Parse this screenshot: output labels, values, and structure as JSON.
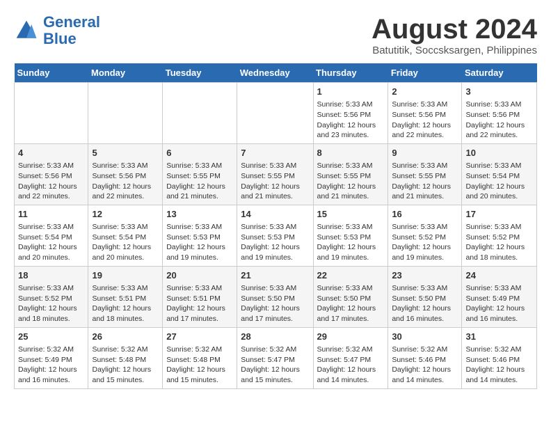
{
  "header": {
    "logo_line1": "General",
    "logo_line2": "Blue",
    "month_title": "August 2024",
    "subtitle": "Batutitik, Soccsksargen, Philippines"
  },
  "weekdays": [
    "Sunday",
    "Monday",
    "Tuesday",
    "Wednesday",
    "Thursday",
    "Friday",
    "Saturday"
  ],
  "weeks": [
    [
      {
        "day": "",
        "info": ""
      },
      {
        "day": "",
        "info": ""
      },
      {
        "day": "",
        "info": ""
      },
      {
        "day": "",
        "info": ""
      },
      {
        "day": "1",
        "info": "Sunrise: 5:33 AM\nSunset: 5:56 PM\nDaylight: 12 hours\nand 23 minutes."
      },
      {
        "day": "2",
        "info": "Sunrise: 5:33 AM\nSunset: 5:56 PM\nDaylight: 12 hours\nand 22 minutes."
      },
      {
        "day": "3",
        "info": "Sunrise: 5:33 AM\nSunset: 5:56 PM\nDaylight: 12 hours\nand 22 minutes."
      }
    ],
    [
      {
        "day": "4",
        "info": "Sunrise: 5:33 AM\nSunset: 5:56 PM\nDaylight: 12 hours\nand 22 minutes."
      },
      {
        "day": "5",
        "info": "Sunrise: 5:33 AM\nSunset: 5:56 PM\nDaylight: 12 hours\nand 22 minutes."
      },
      {
        "day": "6",
        "info": "Sunrise: 5:33 AM\nSunset: 5:55 PM\nDaylight: 12 hours\nand 21 minutes."
      },
      {
        "day": "7",
        "info": "Sunrise: 5:33 AM\nSunset: 5:55 PM\nDaylight: 12 hours\nand 21 minutes."
      },
      {
        "day": "8",
        "info": "Sunrise: 5:33 AM\nSunset: 5:55 PM\nDaylight: 12 hours\nand 21 minutes."
      },
      {
        "day": "9",
        "info": "Sunrise: 5:33 AM\nSunset: 5:55 PM\nDaylight: 12 hours\nand 21 minutes."
      },
      {
        "day": "10",
        "info": "Sunrise: 5:33 AM\nSunset: 5:54 PM\nDaylight: 12 hours\nand 20 minutes."
      }
    ],
    [
      {
        "day": "11",
        "info": "Sunrise: 5:33 AM\nSunset: 5:54 PM\nDaylight: 12 hours\nand 20 minutes."
      },
      {
        "day": "12",
        "info": "Sunrise: 5:33 AM\nSunset: 5:54 PM\nDaylight: 12 hours\nand 20 minutes."
      },
      {
        "day": "13",
        "info": "Sunrise: 5:33 AM\nSunset: 5:53 PM\nDaylight: 12 hours\nand 19 minutes."
      },
      {
        "day": "14",
        "info": "Sunrise: 5:33 AM\nSunset: 5:53 PM\nDaylight: 12 hours\nand 19 minutes."
      },
      {
        "day": "15",
        "info": "Sunrise: 5:33 AM\nSunset: 5:53 PM\nDaylight: 12 hours\nand 19 minutes."
      },
      {
        "day": "16",
        "info": "Sunrise: 5:33 AM\nSunset: 5:52 PM\nDaylight: 12 hours\nand 19 minutes."
      },
      {
        "day": "17",
        "info": "Sunrise: 5:33 AM\nSunset: 5:52 PM\nDaylight: 12 hours\nand 18 minutes."
      }
    ],
    [
      {
        "day": "18",
        "info": "Sunrise: 5:33 AM\nSunset: 5:52 PM\nDaylight: 12 hours\nand 18 minutes."
      },
      {
        "day": "19",
        "info": "Sunrise: 5:33 AM\nSunset: 5:51 PM\nDaylight: 12 hours\nand 18 minutes."
      },
      {
        "day": "20",
        "info": "Sunrise: 5:33 AM\nSunset: 5:51 PM\nDaylight: 12 hours\nand 17 minutes."
      },
      {
        "day": "21",
        "info": "Sunrise: 5:33 AM\nSunset: 5:50 PM\nDaylight: 12 hours\nand 17 minutes."
      },
      {
        "day": "22",
        "info": "Sunrise: 5:33 AM\nSunset: 5:50 PM\nDaylight: 12 hours\nand 17 minutes."
      },
      {
        "day": "23",
        "info": "Sunrise: 5:33 AM\nSunset: 5:50 PM\nDaylight: 12 hours\nand 16 minutes."
      },
      {
        "day": "24",
        "info": "Sunrise: 5:33 AM\nSunset: 5:49 PM\nDaylight: 12 hours\nand 16 minutes."
      }
    ],
    [
      {
        "day": "25",
        "info": "Sunrise: 5:32 AM\nSunset: 5:49 PM\nDaylight: 12 hours\nand 16 minutes."
      },
      {
        "day": "26",
        "info": "Sunrise: 5:32 AM\nSunset: 5:48 PM\nDaylight: 12 hours\nand 15 minutes."
      },
      {
        "day": "27",
        "info": "Sunrise: 5:32 AM\nSunset: 5:48 PM\nDaylight: 12 hours\nand 15 minutes."
      },
      {
        "day": "28",
        "info": "Sunrise: 5:32 AM\nSunset: 5:47 PM\nDaylight: 12 hours\nand 15 minutes."
      },
      {
        "day": "29",
        "info": "Sunrise: 5:32 AM\nSunset: 5:47 PM\nDaylight: 12 hours\nand 14 minutes."
      },
      {
        "day": "30",
        "info": "Sunrise: 5:32 AM\nSunset: 5:46 PM\nDaylight: 12 hours\nand 14 minutes."
      },
      {
        "day": "31",
        "info": "Sunrise: 5:32 AM\nSunset: 5:46 PM\nDaylight: 12 hours\nand 14 minutes."
      }
    ]
  ]
}
